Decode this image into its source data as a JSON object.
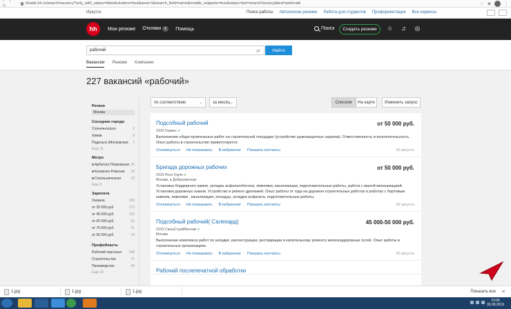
{
  "browser": {
    "url": "irkutsk.hh.ru/search/vacancy?only_with_salary=false&clusters=true&area=1&search_field=name&enable_snippets=true&salary=&st=searchVacancy&text=рабочий"
  },
  "services": {
    "city": "Иркутск",
    "links": [
      "Поиск работы",
      "Автопоиски резюме",
      "Работа для студентов",
      "Профориентация",
      "Все сервисы"
    ]
  },
  "header": {
    "logo": "hh",
    "nav": [
      "Мои резюме",
      "Отклики",
      "Помощь"
    ],
    "responses_count": "5",
    "search_label": "Поиск",
    "create_resume": "Создать резюме"
  },
  "search": {
    "query": "рабочий",
    "button": "Найти",
    "tabs": [
      "Вакансии",
      "Резюме",
      "Компании"
    ]
  },
  "page_title": "227 вакансий «рабочий»",
  "controls": {
    "sort": "по соответствию",
    "period": "за месяц",
    "view_list": "Списком",
    "view_map": "На карте",
    "change_request": "Изменить запрос"
  },
  "filters": {
    "region": {
      "title": "Регион",
      "selected": "Москва"
    },
    "cities": {
      "title": "Соседние города",
      "items": [
        {
          "label": "Солнечногорск",
          "count": "9"
        },
        {
          "label": "Химки",
          "count": "8"
        },
        {
          "label": "Подольск (Московская",
          "count": "7"
        }
      ],
      "more": "Еще 11"
    },
    "metro": {
      "title": "Метро",
      "items": [
        {
          "label": "Арбатско-Покровская",
          "count": "26"
        },
        {
          "label": "Калужско-Рижская",
          "count": "24"
        },
        {
          "label": "Сокольническая",
          "count": "22"
        }
      ],
      "more": "Еще 9"
    },
    "salary": {
      "title": "Зарплата",
      "items": [
        {
          "label": "Указана",
          "count": "193"
        },
        {
          "label": "от 35 000 руб.",
          "count": "170"
        },
        {
          "label": "от 45 000 руб.",
          "count": "122"
        },
        {
          "label": "от 60 000 руб.",
          "count": "51"
        },
        {
          "label": "от 75 000 руб.",
          "count": "21"
        },
        {
          "label": "от 90 000 руб.",
          "count": "14"
        }
      ]
    },
    "prof": {
      "title": "Профобласть",
      "items": [
        {
          "label": "Рабочий персонал",
          "count": "148"
        },
        {
          "label": "Строительство",
          "count": "71"
        },
        {
          "label": "Производство",
          "count": "40"
        }
      ],
      "more": "Еще 16"
    }
  },
  "actions": [
    "Откликнуться",
    "Не показывать",
    "В избранное",
    "Показать контакты"
  ],
  "vacancies": [
    {
      "title": "Подсобный рабочий",
      "salary": "от 50 000 руб.",
      "company": "ООО Гермес",
      "city": "",
      "desc": "Выполнение общестроительных работ на строительной площадке (устройство шумозащитных экранов). Ответственность и исполнительность. Опыт работы в строительстве приветствуется.",
      "date": "30 августа"
    },
    {
      "title": "Бригада дорожных рабочих",
      "salary": "от 50 000 руб.",
      "company": "ООО Ресо Групп",
      "city": "Москва, ● Добрынинская",
      "desc": "Установка бордюрного камня, укладка асфальтобетона, ливневки, канализации, подготовительные работы, работа с малой механизацией. Установка дорожных знаков. Устройство и ремонт дренажей. Опыт работы от года на дорожно-строительных работах и работах с бортовым камнем, ливневки , канализация, колодцы, укладка асфальта, подготовительные работы.",
      "date": "30 августа"
    },
    {
      "title": "Подсобный рабочий( Салехард)",
      "salary": "45 000-50 000 руб.",
      "company": "ООО СилыСтройМонтаж",
      "city": "Москва",
      "desc": "Выполнение комплекса работ по укладке, реконструкции, реставрации и капитальному ремонту железнодорожных путей. Опыт работы в строительных организациях.",
      "date": "30 августа"
    },
    {
      "title": "Рабочий послепечатной обработки",
      "salary": "",
      "company": "",
      "city": "",
      "desc": "",
      "date": ""
    }
  ],
  "downloads": {
    "items": [
      "1.jpg",
      "1.jpg",
      "1.jpg"
    ],
    "show_all": "Показать все"
  },
  "taskbar": {
    "time": "19:06",
    "date": "30.08.2019"
  }
}
